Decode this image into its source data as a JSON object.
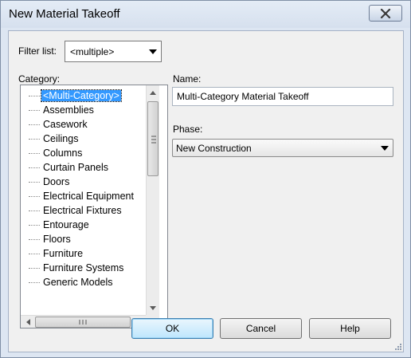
{
  "window": {
    "title": "New Material Takeoff"
  },
  "filter": {
    "label": "Filter list:",
    "value": "<multiple>"
  },
  "category": {
    "label": "Category:",
    "items": [
      "<Multi-Category>",
      "Assemblies",
      "Casework",
      "Ceilings",
      "Columns",
      "Curtain Panels",
      "Doors",
      "Electrical Equipment",
      "Electrical Fixtures",
      "Entourage",
      "Floors",
      "Furniture",
      "Furniture Systems",
      "Generic Models"
    ],
    "selected_index": 0
  },
  "name": {
    "label": "Name:",
    "value": "Multi-Category Material Takeoff"
  },
  "phase": {
    "label": "Phase:",
    "value": "New Construction"
  },
  "buttons": {
    "ok": "OK",
    "cancel": "Cancel",
    "help": "Help"
  },
  "icons": {
    "close": "close-icon",
    "dropdown": "chevron-down-icon",
    "grip": "resize-grip-icon"
  }
}
